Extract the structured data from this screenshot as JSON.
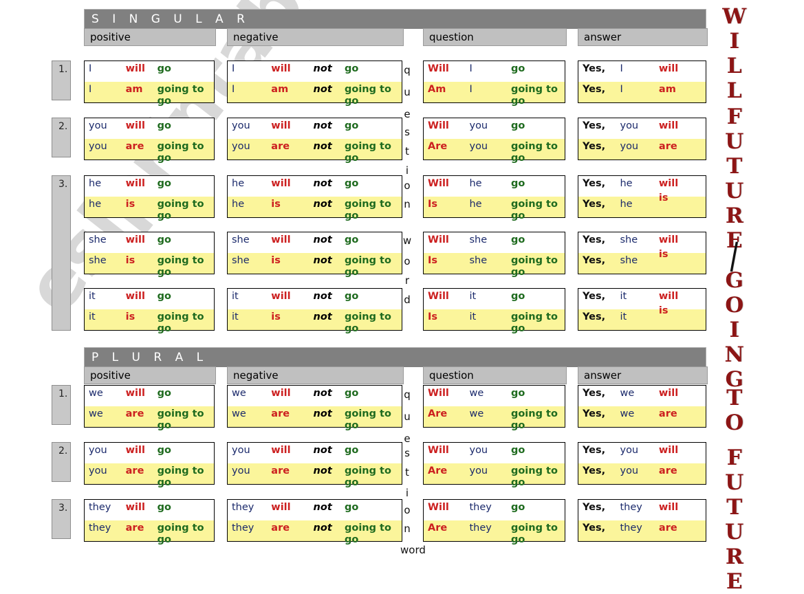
{
  "vertical_title": {
    "line1": "WILL",
    "line2": "FUTURE",
    "separator": "/",
    "line3": "GOING",
    "line4": "TO",
    "line5": "FUTURE"
  },
  "watermark": "eslprintables.com",
  "colors": {
    "banner_bg": "#808080",
    "colhead_bg": "#c0c0c0",
    "numcell_bg": "#c8c8c8",
    "highlight_row": "#fbf59b",
    "subject": "#1b2a6b",
    "auxiliary": "#cc2020",
    "verb": "#1f6b1f",
    "not": "#000000",
    "title": "#8c1515"
  },
  "column_headers": {
    "positive": "positive",
    "negative": "negative",
    "question": "question",
    "answer": "answer"
  },
  "vertical_labels": {
    "question": "question",
    "word": "word"
  },
  "sections": [
    {
      "banner": "SINGULAR",
      "numbers": [
        "1.",
        "2.",
        "3."
      ],
      "rows": [
        {
          "number": "1.",
          "positive": [
            [
              "I",
              "will",
              "go"
            ],
            [
              "I",
              "am",
              "going to go"
            ]
          ],
          "negative": [
            [
              "I",
              "will",
              "not",
              "go"
            ],
            [
              "I",
              "am",
              "not",
              "going to go"
            ]
          ],
          "question": [
            [
              "Will",
              "I",
              "go"
            ],
            [
              "Am",
              "I",
              "going to go"
            ]
          ],
          "answer": [
            [
              "Yes,",
              "I",
              "will"
            ],
            [
              "Yes,",
              "I",
              "am"
            ]
          ]
        },
        {
          "number": "2.",
          "positive": [
            [
              "you",
              "will",
              "go"
            ],
            [
              "you",
              "are",
              "going to go"
            ]
          ],
          "negative": [
            [
              "you",
              "will",
              "not",
              "go"
            ],
            [
              "you",
              "are",
              "not",
              "going to go"
            ]
          ],
          "question": [
            [
              "Will",
              "you",
              "go"
            ],
            [
              "Are",
              "you",
              "going to go"
            ]
          ],
          "answer": [
            [
              "Yes,",
              "you",
              "will"
            ],
            [
              "Yes,",
              "you",
              "are"
            ]
          ]
        },
        {
          "number": "3.",
          "positive": [
            [
              "he",
              "will",
              "go"
            ],
            [
              "he",
              "is",
              "going to go"
            ]
          ],
          "negative": [
            [
              "he",
              "will",
              "not",
              "go"
            ],
            [
              "he",
              "is",
              "not",
              "going to go"
            ]
          ],
          "question": [
            [
              "Will",
              "he",
              "go"
            ],
            [
              "Is",
              "he",
              "going to go"
            ]
          ],
          "answer": [
            [
              "Yes,",
              "he",
              "will"
            ],
            [
              "Yes,",
              "he",
              "is"
            ]
          ]
        },
        {
          "number": "",
          "positive": [
            [
              "she",
              "will",
              "go"
            ],
            [
              "she",
              "is",
              "going to go"
            ]
          ],
          "negative": [
            [
              "she",
              "will",
              "not",
              "go"
            ],
            [
              "she",
              "is",
              "not",
              "going to go"
            ]
          ],
          "question": [
            [
              "Will",
              "she",
              "go"
            ],
            [
              "Is",
              "she",
              "going to go"
            ]
          ],
          "answer": [
            [
              "Yes,",
              "she",
              "will"
            ],
            [
              "Yes,",
              "she",
              "is"
            ]
          ]
        },
        {
          "number": "",
          "positive": [
            [
              "it",
              "will",
              "go"
            ],
            [
              "it",
              "is",
              "going to go"
            ]
          ],
          "negative": [
            [
              "it",
              "will",
              "not",
              "go"
            ],
            [
              "it",
              "is",
              "not",
              "going to go"
            ]
          ],
          "question": [
            [
              "Will",
              "it",
              "go"
            ],
            [
              "Is",
              "it",
              "going to go"
            ]
          ],
          "answer": [
            [
              "Yes,",
              "it",
              "will"
            ],
            [
              "Yes,",
              "it",
              "is"
            ]
          ]
        }
      ]
    },
    {
      "banner": "PLURAL",
      "numbers": [
        "1.",
        "2.",
        "3."
      ],
      "rows": [
        {
          "number": "1.",
          "positive": [
            [
              "we",
              "will",
              "go"
            ],
            [
              "we",
              "are",
              "going to go"
            ]
          ],
          "negative": [
            [
              "we",
              "will",
              "not",
              "go"
            ],
            [
              "we",
              "are",
              "not",
              "going to go"
            ]
          ],
          "question": [
            [
              "Will",
              "we",
              "go"
            ],
            [
              "Are",
              "we",
              "going to go"
            ]
          ],
          "answer": [
            [
              "Yes,",
              "we",
              "will"
            ],
            [
              "Yes,",
              "we",
              "are"
            ]
          ]
        },
        {
          "number": "2.",
          "positive": [
            [
              "you",
              "will",
              "go"
            ],
            [
              "you",
              "are",
              "going to go"
            ]
          ],
          "negative": [
            [
              "you",
              "will",
              "not",
              "go"
            ],
            [
              "you",
              "are",
              "not",
              "going to go"
            ]
          ],
          "question": [
            [
              "Will",
              "you",
              "go"
            ],
            [
              "Are",
              "you",
              "going to go"
            ]
          ],
          "answer": [
            [
              "Yes,",
              "you",
              "will"
            ],
            [
              "Yes,",
              "you",
              "are"
            ]
          ]
        },
        {
          "number": "3.",
          "positive": [
            [
              "they",
              "will",
              "go"
            ],
            [
              "they",
              "are",
              "going to go"
            ]
          ],
          "negative": [
            [
              "they",
              "will",
              "not",
              "go"
            ],
            [
              "they",
              "are",
              "not",
              "going to go"
            ]
          ],
          "question": [
            [
              "Will",
              "they",
              "go"
            ],
            [
              "Are",
              "they",
              "going to go"
            ]
          ],
          "answer": [
            [
              "Yes,",
              "they",
              "will"
            ],
            [
              "Yes,",
              "they",
              "are"
            ]
          ]
        }
      ]
    }
  ]
}
